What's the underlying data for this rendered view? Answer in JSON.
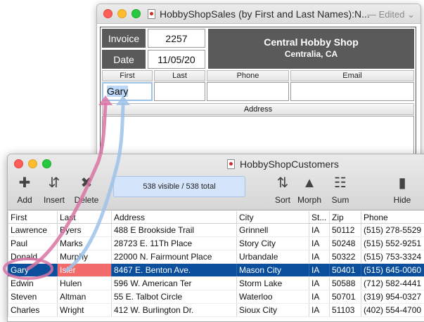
{
  "back_window": {
    "title": "HobbyShopSales (by First and Last Names):N...",
    "status": "— Edited ⌄",
    "invoice_label": "Invoice",
    "invoice_value": "2257",
    "date_label": "Date",
    "date_value": "11/05/20",
    "shop_name": "Central Hobby Shop",
    "shop_city": "Centralia, CA",
    "columns": {
      "first": "First",
      "last": "Last",
      "phone": "Phone",
      "email": "Email"
    },
    "first_value": "Gary",
    "address_label": "Address"
  },
  "front_window": {
    "title": "HobbyShopCustomers",
    "count_text": "538 visible / 538 total",
    "toolbar": {
      "add": "Add",
      "insert": "Insert",
      "delete": "Delete",
      "sort": "Sort",
      "morph": "Morph",
      "sum": "Sum",
      "hide": "Hide"
    },
    "icons": {
      "add": "plus-down-arrow-icon",
      "insert": "plus-up-down-arrow-icon",
      "delete": "x-icon",
      "sort": "sort-icon",
      "morph": "flask-icon",
      "sum": "sum-icon",
      "hide": "bookmark-icon"
    },
    "table": {
      "headers": [
        "First",
        "Last",
        "Address",
        "City",
        "St...",
        "Zip",
        "Phone"
      ],
      "rows": [
        [
          "Lawrence",
          "Byers",
          "488 E Brookside Trail",
          "Grinnell",
          "IA",
          "50112",
          "(515) 278-5529"
        ],
        [
          "Paul",
          "Marks",
          "28723 E. 11Th Place",
          "Story City",
          "IA",
          "50248",
          "(515) 552-9251"
        ],
        [
          "Donald",
          "Murphy",
          "22000 N. Fairmount Place",
          "Urbandale",
          "IA",
          "50322",
          "(515) 753-3324"
        ],
        [
          "Gary",
          "Isler",
          "8467 E. Benton Ave.",
          "Mason City",
          "IA",
          "50401",
          "(515) 645-0060"
        ],
        [
          "Edwin",
          "Hulen",
          "596 W. American Ter",
          "Storm Lake",
          "IA",
          "50588",
          "(712) 582-4441"
        ],
        [
          "Steven",
          "Altman",
          "55 E. Talbot Circle",
          "Waterloo",
          "IA",
          "50701",
          "(319) 954-0327"
        ],
        [
          "Charles",
          "Wright",
          "412 W. Burlington Dr.",
          "Sioux City",
          "IA",
          "51103",
          "(402) 554-4700"
        ]
      ],
      "selected_row": 3
    }
  },
  "colors": {
    "selection": "#0b4f9c",
    "highlight_cell": "#f26b6b",
    "arrow_pink": "#d873a4",
    "arrow_blue": "#9cc2ea"
  }
}
